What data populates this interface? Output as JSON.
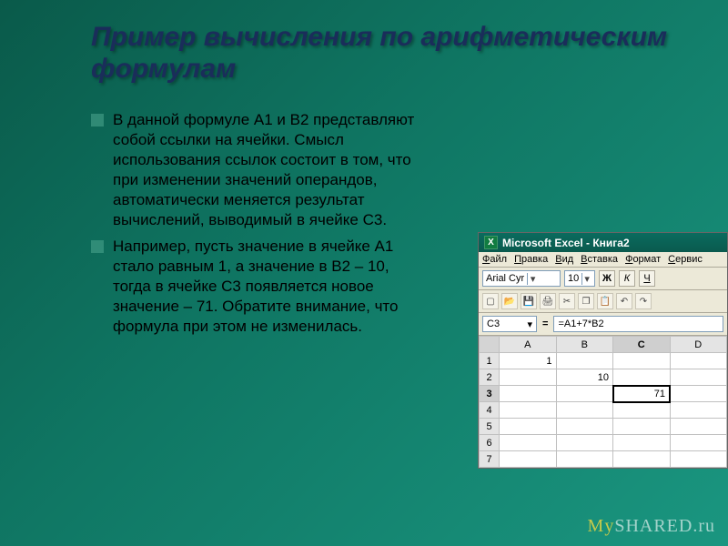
{
  "slide": {
    "title": "Пример вычисления по арифметическим формулам",
    "bullets": [
      "В данной формуле А1 и В2 представляют собой ссылки на ячейки. Смысл использования ссылок состоит в том, что при изменении значений операндов, автоматически меняется результат вычислений, выводимый в ячейке С3.",
      "Например, пусть значение в ячейке А1 стало равным 1, а значение в В2 – 10, тогда в ячейке С3 появляется новое значение – 71. Обратите внимание, что формула при этом не изменилась."
    ]
  },
  "excel": {
    "app_title": "Microsoft Excel - Книга2",
    "menus": [
      "Файл",
      "Правка",
      "Вид",
      "Вставка",
      "Формат",
      "Сервис"
    ],
    "font_name": "Arial Cyr",
    "font_size": "10",
    "style_bold": "Ж",
    "style_italic": "К",
    "style_underline": "Ч",
    "name_box": "C3",
    "eq": "=",
    "formula": "=A1+7*B2",
    "columns": [
      "A",
      "B",
      "C",
      "D"
    ],
    "rows": [
      "1",
      "2",
      "3",
      "4",
      "5",
      "6",
      "7"
    ],
    "active_col": "C",
    "active_row": "3",
    "cells": {
      "A1": "1",
      "B2": "10",
      "C3": "71"
    }
  },
  "watermark": {
    "my": "My",
    "rest": "SHARED.ru"
  }
}
